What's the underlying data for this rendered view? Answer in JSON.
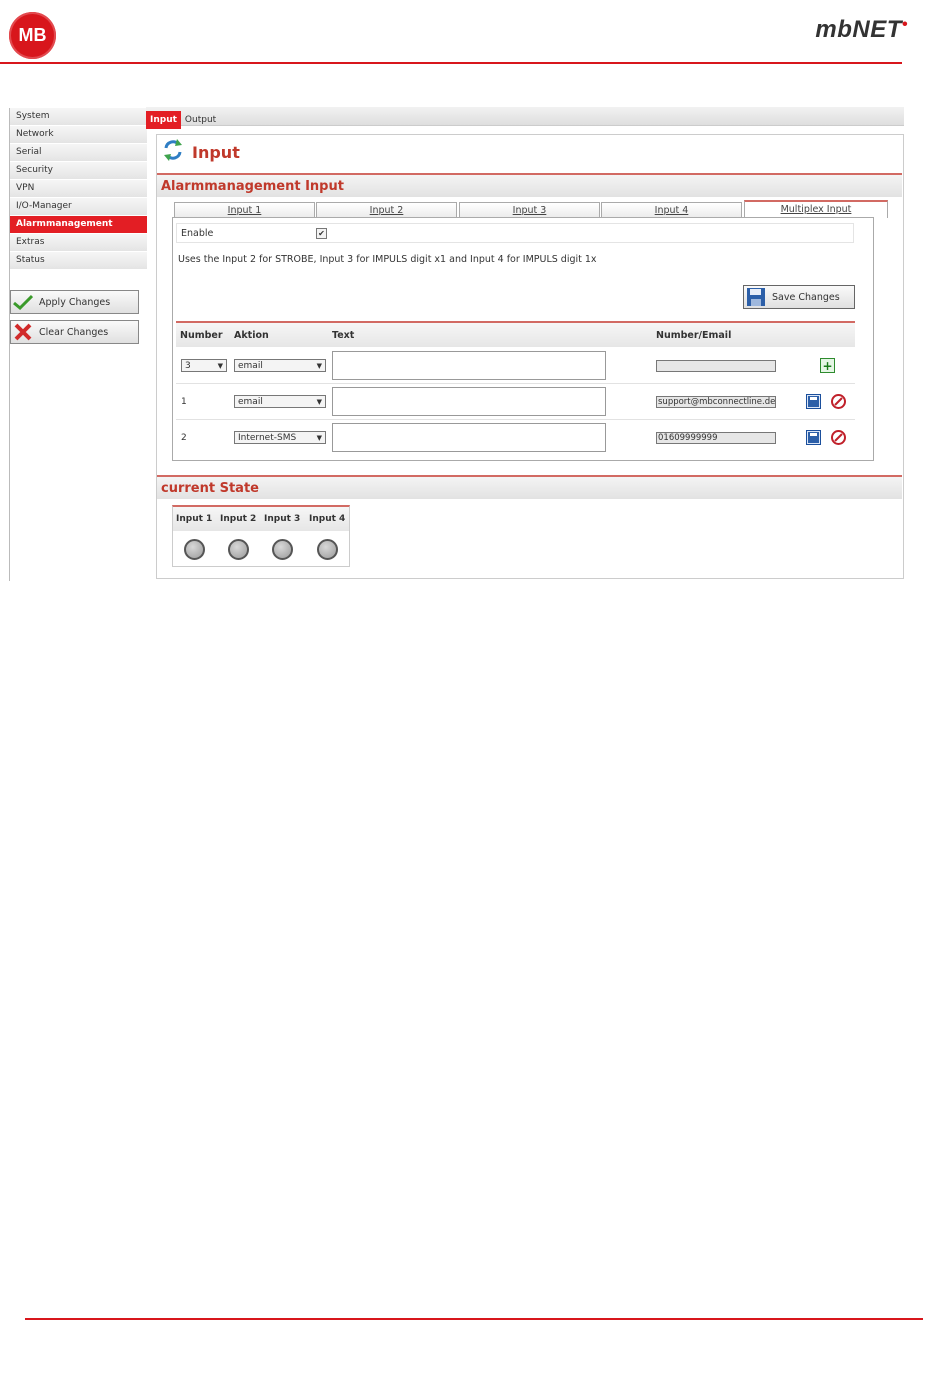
{
  "header": {
    "logo_text": "MB",
    "brand": "mbNET",
    "brand_mark": "•"
  },
  "sidebar": {
    "items": [
      {
        "label": "System",
        "active": false
      },
      {
        "label": "Network",
        "active": false
      },
      {
        "label": "Serial",
        "active": false
      },
      {
        "label": "Security",
        "active": false
      },
      {
        "label": "VPN",
        "active": false
      },
      {
        "label": "I/O-Manager",
        "active": false
      },
      {
        "label": "Alarmmanagement",
        "active": true
      },
      {
        "label": "Extras",
        "active": false
      },
      {
        "label": "Status",
        "active": false
      }
    ],
    "apply_label": "Apply Changes",
    "clear_label": "Clear Changes"
  },
  "top_tabs": [
    {
      "label": "Input",
      "active": true
    },
    {
      "label": "Output",
      "active": false
    }
  ],
  "page_title": "Input",
  "section_title": "Alarmmanagement Input",
  "sub_tabs": [
    {
      "label": "Input 1",
      "active": false
    },
    {
      "label": "Input 2",
      "active": false
    },
    {
      "label": "Input 3",
      "active": false
    },
    {
      "label": "Input 4",
      "active": false
    },
    {
      "label": "Multiplex Input",
      "active": true
    }
  ],
  "enable": {
    "label": "Enable",
    "checked": true,
    "check_glyph": "✔"
  },
  "description": "Uses the Input 2 for STROBE, Input 3 for IMPULS digit x1 and Input 4 for IMPULS digit 1x",
  "save_label": "Save Changes",
  "table": {
    "headers": {
      "number": "Number",
      "aktion": "Aktion",
      "text": "Text",
      "email": "Number/Email"
    },
    "new_row": {
      "number": "3",
      "aktion": "email",
      "text": "",
      "email": ""
    },
    "rows": [
      {
        "number": "1",
        "aktion": "email",
        "text": "",
        "email": "support@mbconnectline.de"
      },
      {
        "number": "2",
        "aktion": "Internet-SMS",
        "text": "",
        "email": "01609999999"
      }
    ],
    "select_arrow": "▼"
  },
  "state": {
    "title": "current State",
    "inputs": [
      "Input 1",
      "Input 2",
      "Input 3",
      "Input 4"
    ]
  },
  "colors": {
    "accent": "#e31e24",
    "section_text": "#c0392b"
  }
}
